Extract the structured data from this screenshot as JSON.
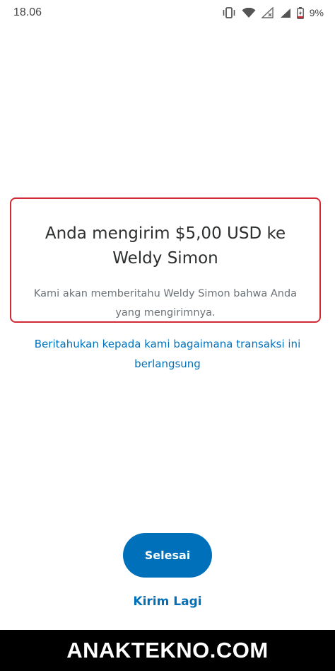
{
  "status_bar": {
    "time": "18.06",
    "battery_percent": "9%",
    "icons": [
      "vibrate-icon",
      "wifi-icon",
      "signal-empty-icon",
      "signal-icon",
      "battery-charging-icon"
    ]
  },
  "confirmation": {
    "title": "Anda mengirim $5,00 USD ke Weldy Simon",
    "subtitle": "Kami akan memberitahu Weldy Simon bahwa Anda yang mengirimnya."
  },
  "feedback_link": "Beritahukan kepada kami bagaimana transaksi ini berlangsung",
  "actions": {
    "done_label": "Selesai",
    "send_again_label": "Kirim Lagi"
  },
  "watermark": "ANAKTEKNO.COM",
  "colors": {
    "accent": "#0070ba",
    "highlight_border": "#d12a34",
    "watermark_bg": "#000000"
  }
}
